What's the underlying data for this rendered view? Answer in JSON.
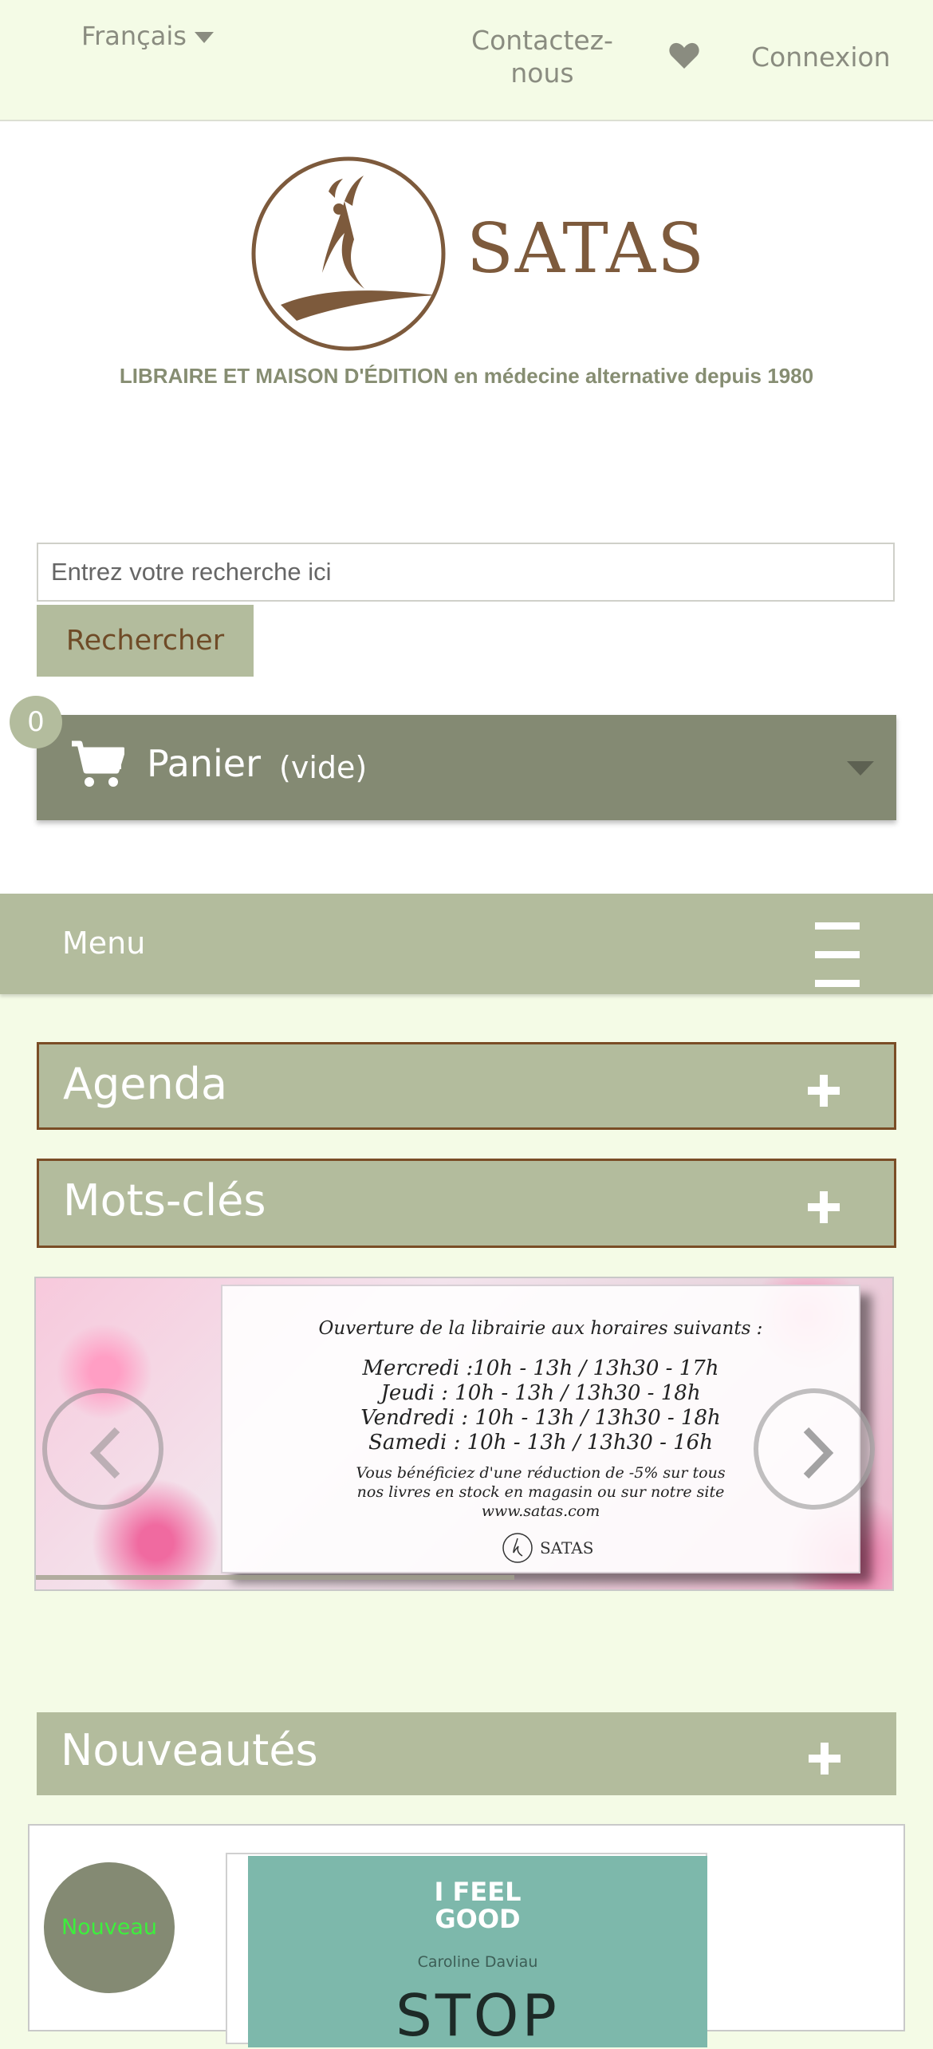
{
  "topnav": {
    "language": "Français",
    "contact_line1": "Contactez-",
    "contact_line2": "nous",
    "login": "Connexion"
  },
  "brand": {
    "name": "SATAS",
    "tagline": "LIBRAIRE ET MAISON D'ÉDITION en médecine alternative depuis 1980"
  },
  "search": {
    "placeholder": "Entrez votre recherche ici",
    "button": "Rechercher"
  },
  "cart": {
    "count": "0",
    "label": "Panier",
    "status": "(vide)"
  },
  "menu": {
    "label": "Menu"
  },
  "blocks": {
    "agenda": "Agenda",
    "keywords": "Mots-clés",
    "new_releases": "Nouveautés"
  },
  "slider": {
    "heading": "Ouverture de la librairie aux horaires suivants :",
    "hours": [
      "Mercredi :10h - 13h / 13h30 - 17h",
      "Jeudi : 10h - 13h  / 13h30 - 18h",
      "Vendredi : 10h - 13h  / 13h30 - 18h",
      "Samedi : 10h - 13h  / 13h30 - 16h"
    ],
    "note_line1": "Vous bénéficiez d'une réduction de -5% sur tous",
    "note_line2": "nos livres en stock en magasin ou sur notre site",
    "note_line3": "www.satas.com",
    "brand": "SATAS"
  },
  "product": {
    "badge": "Nouveau",
    "cover_line1": "I FEEL",
    "cover_line2": "GOOD",
    "cover_author": "Caroline Daviau",
    "cover_title": "STOP"
  },
  "colors": {
    "nav_bg": "#f4fbe6",
    "accent_green": "#b3bc9d",
    "cart_bg": "#848a73",
    "brand_brown": "#7d5a3c"
  }
}
